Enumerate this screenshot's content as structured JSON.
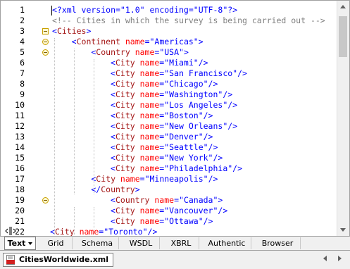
{
  "lines": [
    {
      "n": "1",
      "parts": [
        [
          "pi",
          "<?xml version=\"1.0\" encoding=\"UTF-8\"?>"
        ]
      ]
    },
    {
      "n": "2",
      "parts": [
        [
          "comment",
          "<!-- Cities in which the survey is being carried out -->"
        ]
      ]
    },
    {
      "n": "3",
      "parts": [
        [
          "bracket",
          "<"
        ],
        [
          "tag",
          "Cities"
        ],
        [
          "bracket",
          ">"
        ]
      ]
    },
    {
      "n": "4",
      "parts": [
        [
          "bracket",
          "<"
        ],
        [
          "tag",
          "Continent "
        ],
        [
          "attr",
          "name"
        ],
        [
          "eq",
          "="
        ],
        [
          "val",
          "\"Americas\""
        ],
        [
          "bracket",
          ">"
        ]
      ]
    },
    {
      "n": "5",
      "parts": [
        [
          "bracket",
          "<"
        ],
        [
          "tag",
          "Country "
        ],
        [
          "attr",
          "name"
        ],
        [
          "eq",
          "="
        ],
        [
          "val",
          "\"USA\""
        ],
        [
          "bracket",
          ">"
        ]
      ]
    },
    {
      "n": "6",
      "parts": [
        [
          "bracket",
          "<"
        ],
        [
          "tag",
          "City "
        ],
        [
          "attr",
          "name"
        ],
        [
          "eq",
          "="
        ],
        [
          "val",
          "\"Miami\""
        ],
        [
          "bracket",
          "/>"
        ]
      ]
    },
    {
      "n": "7",
      "parts": [
        [
          "bracket",
          "<"
        ],
        [
          "tag",
          "City "
        ],
        [
          "attr",
          "name"
        ],
        [
          "eq",
          "="
        ],
        [
          "val",
          "\"San Francisco\""
        ],
        [
          "bracket",
          "/>"
        ]
      ]
    },
    {
      "n": "8",
      "parts": [
        [
          "bracket",
          "<"
        ],
        [
          "tag",
          "City "
        ],
        [
          "attr",
          "name"
        ],
        [
          "eq",
          "="
        ],
        [
          "val",
          "\"Chicago\""
        ],
        [
          "bracket",
          "/>"
        ]
      ]
    },
    {
      "n": "9",
      "parts": [
        [
          "bracket",
          "<"
        ],
        [
          "tag",
          "City "
        ],
        [
          "attr",
          "name"
        ],
        [
          "eq",
          "="
        ],
        [
          "val",
          "\"Washington\""
        ],
        [
          "bracket",
          "/>"
        ]
      ]
    },
    {
      "n": "10",
      "parts": [
        [
          "bracket",
          "<"
        ],
        [
          "tag",
          "City "
        ],
        [
          "attr",
          "name"
        ],
        [
          "eq",
          "="
        ],
        [
          "val",
          "\"Los Angeles\""
        ],
        [
          "bracket",
          "/>"
        ]
      ]
    },
    {
      "n": "11",
      "parts": [
        [
          "bracket",
          "<"
        ],
        [
          "tag",
          "City "
        ],
        [
          "attr",
          "name"
        ],
        [
          "eq",
          "="
        ],
        [
          "val",
          "\"Boston\""
        ],
        [
          "bracket",
          "/>"
        ]
      ]
    },
    {
      "n": "12",
      "parts": [
        [
          "bracket",
          "<"
        ],
        [
          "tag",
          "City "
        ],
        [
          "attr",
          "name"
        ],
        [
          "eq",
          "="
        ],
        [
          "val",
          "\"New Orleans\""
        ],
        [
          "bracket",
          "/>"
        ]
      ]
    },
    {
      "n": "13",
      "parts": [
        [
          "bracket",
          "<"
        ],
        [
          "tag",
          "City "
        ],
        [
          "attr",
          "name"
        ],
        [
          "eq",
          "="
        ],
        [
          "val",
          "\"Denver\""
        ],
        [
          "bracket",
          "/>"
        ]
      ]
    },
    {
      "n": "14",
      "parts": [
        [
          "bracket",
          "<"
        ],
        [
          "tag",
          "City "
        ],
        [
          "attr",
          "name"
        ],
        [
          "eq",
          "="
        ],
        [
          "val",
          "\"Seattle\""
        ],
        [
          "bracket",
          "/>"
        ]
      ]
    },
    {
      "n": "15",
      "parts": [
        [
          "bracket",
          "<"
        ],
        [
          "tag",
          "City "
        ],
        [
          "attr",
          "name"
        ],
        [
          "eq",
          "="
        ],
        [
          "val",
          "\"New York\""
        ],
        [
          "bracket",
          "/>"
        ]
      ]
    },
    {
      "n": "16",
      "parts": [
        [
          "bracket",
          "<"
        ],
        [
          "tag",
          "City "
        ],
        [
          "attr",
          "name"
        ],
        [
          "eq",
          "="
        ],
        [
          "val",
          "\"Philadelphia\""
        ],
        [
          "bracket",
          "/>"
        ]
      ]
    },
    {
      "n": "17",
      "parts": [
        [
          "bracket",
          "<"
        ],
        [
          "tag",
          "City "
        ],
        [
          "attr",
          "name"
        ],
        [
          "eq",
          "="
        ],
        [
          "val",
          "\"Minneapolis\""
        ],
        [
          "bracket",
          "/>"
        ]
      ]
    },
    {
      "n": "18",
      "parts": [
        [
          "bracket",
          "</"
        ],
        [
          "tag",
          "Country"
        ],
        [
          "bracket",
          ">"
        ]
      ]
    },
    {
      "n": "19",
      "parts": [
        [
          "bracket",
          "<"
        ],
        [
          "tag",
          "Country "
        ],
        [
          "attr",
          "name"
        ],
        [
          "eq",
          "="
        ],
        [
          "val",
          "\"Canada\""
        ],
        [
          "bracket",
          ">"
        ]
      ]
    },
    {
      "n": "20",
      "parts": [
        [
          "bracket",
          "<"
        ],
        [
          "tag",
          "City "
        ],
        [
          "attr",
          "name"
        ],
        [
          "eq",
          "="
        ],
        [
          "val",
          "\"Vancouver\""
        ],
        [
          "bracket",
          "/>"
        ]
      ]
    },
    {
      "n": "21",
      "parts": [
        [
          "bracket",
          "<"
        ],
        [
          "tag",
          "City "
        ],
        [
          "attr",
          "name"
        ],
        [
          "eq",
          "="
        ],
        [
          "val",
          "\"Ottawa\""
        ],
        [
          "bracket",
          "/>"
        ]
      ]
    },
    {
      "n": "22",
      "parts": [
        [
          "bracket",
          "<"
        ],
        [
          "tag",
          "City "
        ],
        [
          "attr",
          "name"
        ],
        [
          "eq",
          "="
        ],
        [
          "val",
          "\"Toronto\""
        ],
        [
          "bracket",
          "/>"
        ]
      ]
    }
  ],
  "view_tabs": [
    {
      "label": "Text",
      "active": true,
      "dropdown": true
    },
    {
      "label": "Grid"
    },
    {
      "label": "Schema"
    },
    {
      "label": "WSDL"
    },
    {
      "label": "XBRL"
    },
    {
      "label": "Authentic"
    },
    {
      "label": "Browser"
    }
  ],
  "file_tab": {
    "label": "CitiesWorldwide.xml",
    "icon": "xml-file-icon"
  },
  "icons": {
    "splitter": "split-view-icon",
    "nav_left": "nav-left-icon",
    "nav_right": "nav-right-icon"
  }
}
